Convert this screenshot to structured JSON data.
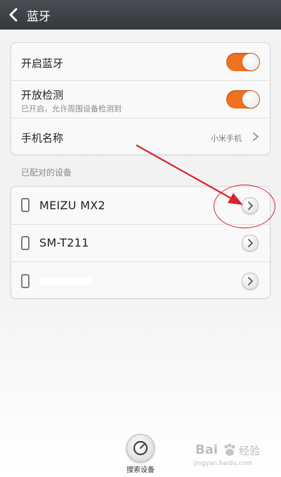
{
  "titlebar": {
    "title": "蓝牙"
  },
  "settings": {
    "bluetooth_toggle": {
      "label": "开启蓝牙",
      "state": "on"
    },
    "visibility_toggle": {
      "label": "开放检测",
      "sublabel": "已开启，允许周围设备检测到",
      "state": "on"
    },
    "device_name": {
      "label": "手机名称",
      "value": "小米手机"
    }
  },
  "paired": {
    "header": "已配对的设备",
    "devices": [
      {
        "name": "MEIZU MX2"
      },
      {
        "name": "SM-T211"
      },
      {
        "name": ""
      }
    ]
  },
  "bottom": {
    "search_label": "搜索设备"
  },
  "watermark": {
    "brand": "Bai",
    "brand2": "经验",
    "url": "jingyan.baidu.com"
  },
  "colors": {
    "accent": "#f07122",
    "annotation": "#d9232b",
    "titlebar": "#3a3d41"
  }
}
